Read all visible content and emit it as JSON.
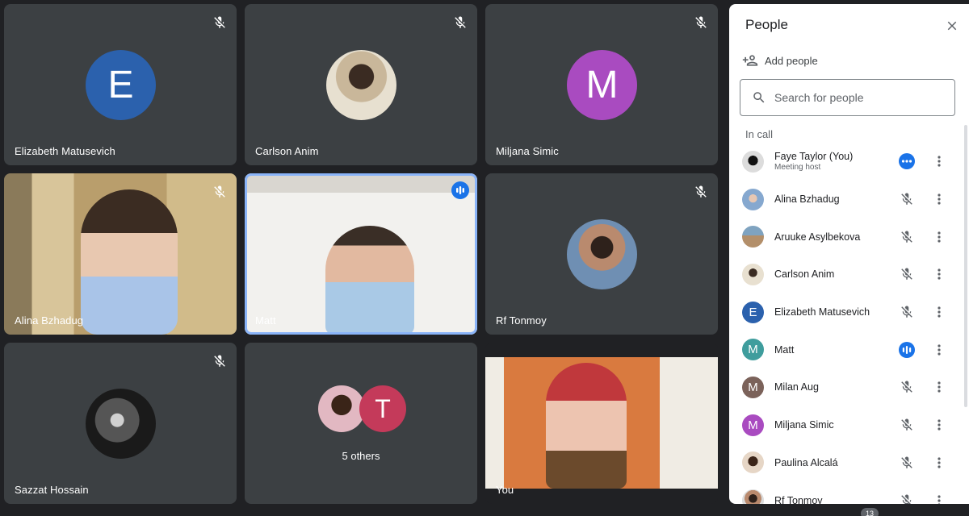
{
  "tiles": [
    {
      "name": "Elizabeth Matusevich",
      "initial": "E",
      "avatar_color": "#2b61ad"
    },
    {
      "name": "Carlson Anim"
    },
    {
      "name": "Miljana Simic",
      "initial": "M",
      "avatar_color": "#a94bc0"
    },
    {
      "name": "Alina Bzhadug"
    },
    {
      "name": "Matt"
    },
    {
      "name": "Rf Tonmoy"
    },
    {
      "name": "Sazzat Hossain"
    },
    {
      "name": "5 others",
      "initial": "T",
      "avatar_color": "#c43a5a"
    },
    {
      "name": "You"
    }
  ],
  "panel": {
    "title": "People",
    "add_people": "Add people",
    "search_placeholder": "Search for people",
    "section": "In call",
    "people": [
      {
        "name": "Faye Taylor (You)",
        "sub": "Meeting host",
        "status": "more-options-icon"
      },
      {
        "name": "Alina Bzhadug",
        "status": "mic-off-icon"
      },
      {
        "name": "Aruuke Asylbekova",
        "status": "mic-off-icon"
      },
      {
        "name": "Carlson Anim",
        "status": "mic-off-icon"
      },
      {
        "name": "Elizabeth Matusevich",
        "initial": "E",
        "color": "#2b61ad",
        "status": "mic-off-icon"
      },
      {
        "name": "Matt",
        "initial": "M",
        "color": "#3f9d9d",
        "status": "speaking-icon"
      },
      {
        "name": "Milan Aug",
        "initial": "M",
        "color": "#7b625a",
        "status": "mic-off-icon"
      },
      {
        "name": "Miljana Simic",
        "initial": "M",
        "color": "#a94bc0",
        "status": "mic-off-icon"
      },
      {
        "name": "Paulina Alcalá",
        "status": "mic-off-icon"
      },
      {
        "name": "Rf Tonmoy",
        "status": "mic-off-icon"
      }
    ]
  },
  "participant_count": "13",
  "colors": {
    "accent": "#1a73e8",
    "tile_bg": "#3c4043",
    "page_bg": "#202124",
    "speaking_border": "#8ab4f8"
  }
}
